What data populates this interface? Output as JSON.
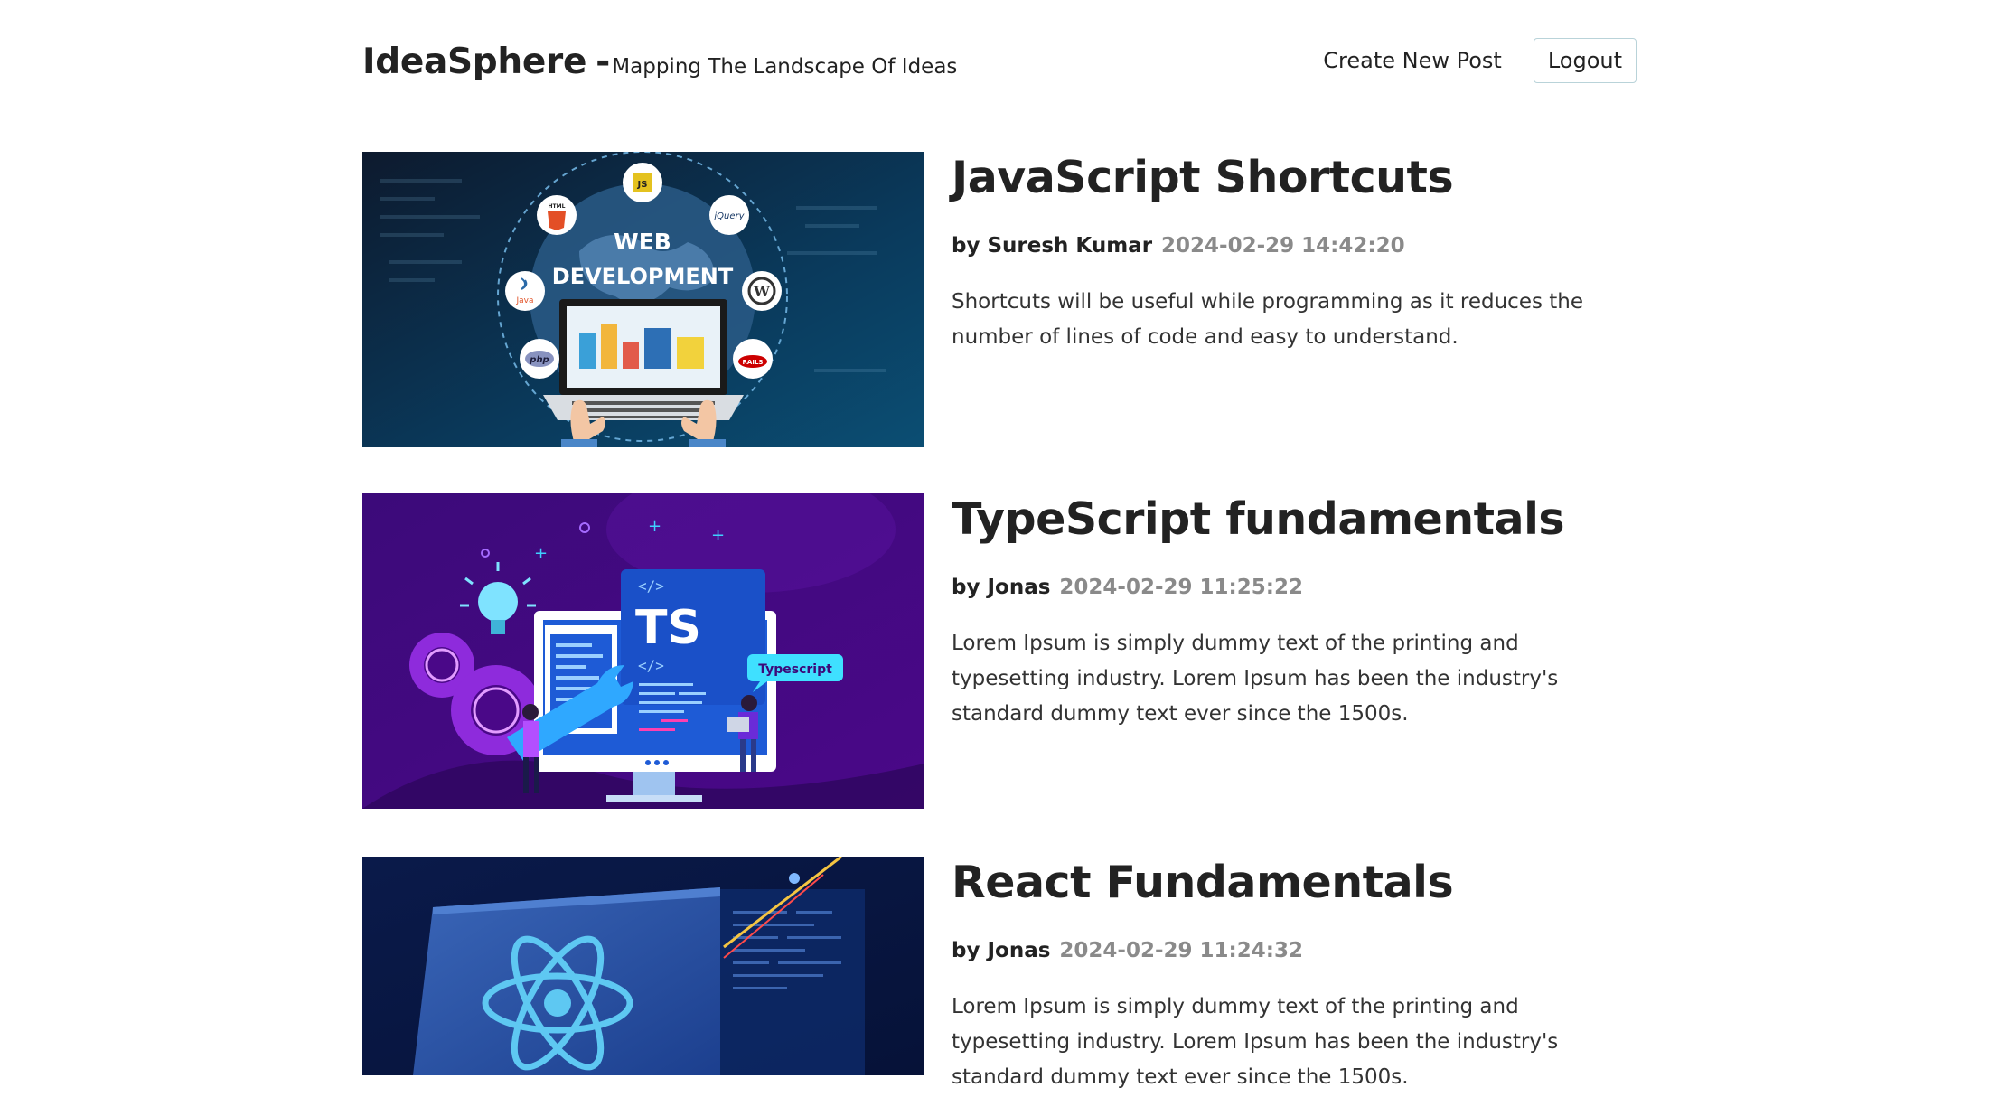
{
  "brand": {
    "title": "IdeaSphere",
    "separator": "-",
    "tagline": "Mapping The Landscape Of Ideas"
  },
  "nav": {
    "create_post": "Create New Post",
    "logout": "Logout"
  },
  "posts": [
    {
      "title": "JavaScript Shortcuts",
      "author": "by Suresh Kumar",
      "date": "2024-02-29 14:42:20",
      "summary": "Shortcuts will be useful while programming as it reduces the number of lines of code and easy to understand.",
      "image": {
        "line1": "WEB",
        "line2": "DEVELOPMENT",
        "badges": [
          "JS",
          "HTML",
          "jQuery",
          "Java",
          "php",
          "RAILS"
        ]
      }
    },
    {
      "title": "TypeScript fundamentals",
      "author": "by Jonas",
      "date": "2024-02-29 11:25:22",
      "summary": "Lorem Ipsum is simply dummy text of the printing and typesetting industry. Lorem Ipsum has been the industry's standard dummy text ever since the 1500s.",
      "image": {
        "screen_label": "TS",
        "tag_top": "</>",
        "tag_bottom": "</>",
        "bubble": "Typescript"
      }
    },
    {
      "title": "React Fundamentals",
      "author": "by Jonas",
      "date": "2024-02-29 11:24:32",
      "summary": "Lorem Ipsum is simply dummy text of the printing and typesetting industry. Lorem Ipsum has been the industry's standard dummy text ever since the 1500s.",
      "image": {}
    }
  ]
}
